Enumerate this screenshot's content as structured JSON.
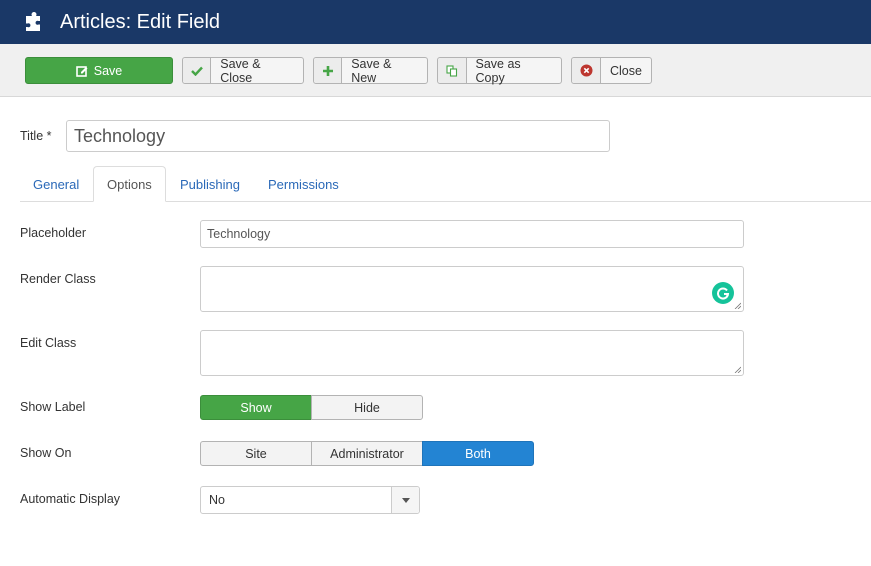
{
  "header": {
    "title": "Articles: Edit Field",
    "icon": "puzzle-icon"
  },
  "toolbar": {
    "save": {
      "label": "Save",
      "icon": "edit-icon"
    },
    "save_close": {
      "label": "Save & Close",
      "icon": "check-icon"
    },
    "save_new": {
      "label": "Save & New",
      "icon": "plus-icon"
    },
    "save_copy": {
      "label": "Save as Copy",
      "icon": "copy-icon"
    },
    "close": {
      "label": "Close",
      "icon": "close-circle-icon"
    }
  },
  "form": {
    "title_label": "Title *",
    "title_value": "Technology"
  },
  "tabs": [
    {
      "label": "General",
      "active": false
    },
    {
      "label": "Options",
      "active": true
    },
    {
      "label": "Publishing",
      "active": false
    },
    {
      "label": "Permissions",
      "active": false
    }
  ],
  "options": {
    "placeholder": {
      "label": "Placeholder",
      "value": "Technology"
    },
    "render_class": {
      "label": "Render Class",
      "value": ""
    },
    "edit_class": {
      "label": "Edit Class",
      "value": ""
    },
    "show_label": {
      "label": "Show Label",
      "options": [
        "Show",
        "Hide"
      ],
      "selected": "Show"
    },
    "show_on": {
      "label": "Show On",
      "options": [
        "Site",
        "Administrator",
        "Both"
      ],
      "selected": "Both"
    },
    "automatic_display": {
      "label": "Automatic Display",
      "value": "No"
    }
  },
  "colors": {
    "header_bg": "#1a3867",
    "success": "#46a546",
    "primary": "#2384d3",
    "link": "#2a69b8",
    "danger": "#bd362f",
    "grammarly": "#15c39a"
  }
}
